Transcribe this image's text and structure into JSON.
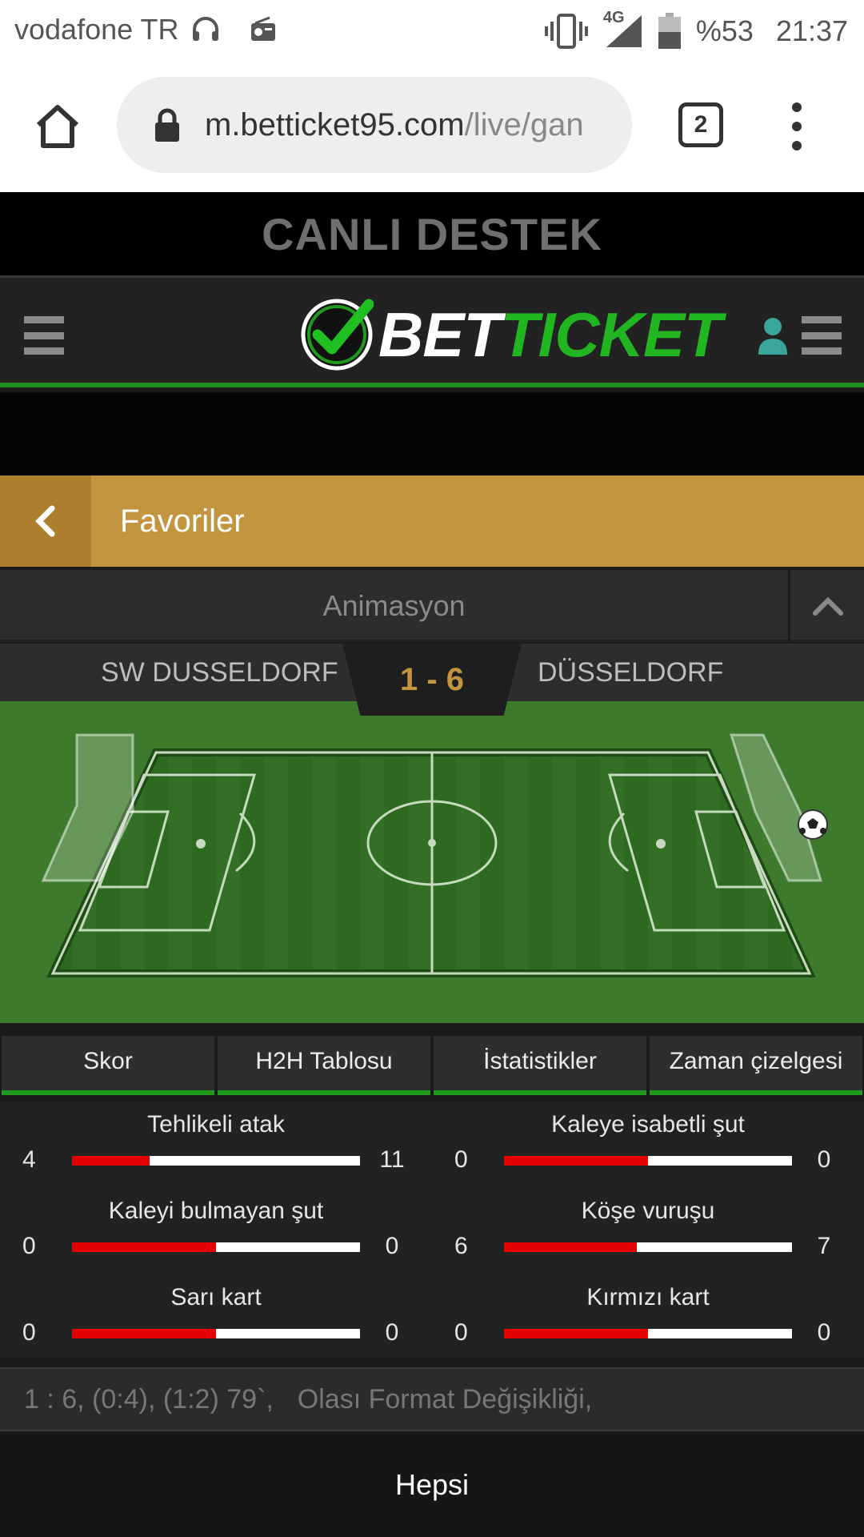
{
  "status_bar": {
    "carrier": "vodafone TR",
    "network": "4G",
    "battery": "%53",
    "time": "21:37",
    "icons": [
      "headset-icon",
      "radio-icon",
      "vibrate-icon",
      "signal-icon",
      "battery-icon"
    ]
  },
  "browser": {
    "url_host": "m.betticket95.com",
    "url_path": "/live/gan",
    "tab_count": "2"
  },
  "support_banner": "CANLI DESTEK",
  "header": {
    "logo_part1": "BET",
    "logo_part2": "TICKET",
    "colors": {
      "accent_green": "#1f9a1f",
      "gold": "#c4953f"
    }
  },
  "favorites": {
    "title": "Favoriler"
  },
  "animation": {
    "label": "Animasyon"
  },
  "match": {
    "home_team": "SW DUSSELDORF",
    "away_team": "DÜSSELDORF",
    "score": "1 - 6"
  },
  "tabs": [
    "Skor",
    "H2H Tablosu",
    "İstatistikler",
    "Zaman çizelgesi"
  ],
  "stats": [
    {
      "title": "Tehlikeli atak",
      "home": "4",
      "away": "11",
      "home_fraction": 0.27
    },
    {
      "title": "Kaleye isabetli şut",
      "home": "0",
      "away": "0",
      "home_fraction": 0.5
    },
    {
      "title": "Kaleyi bulmayan şut",
      "home": "0",
      "away": "0",
      "home_fraction": 0.5
    },
    {
      "title": "Köşe vuruşu",
      "home": "6",
      "away": "7",
      "home_fraction": 0.46
    },
    {
      "title": "Sarı kart",
      "home": "0",
      "away": "0",
      "home_fraction": 0.5
    },
    {
      "title": "Kırmızı kart",
      "home": "0",
      "away": "0",
      "home_fraction": 0.5
    }
  ],
  "event_line": {
    "score_detail": "1 : 6, (0:4), (1:2) 79`,",
    "note": "Olası Format Değişikliği,"
  },
  "footer": {
    "label": "Hepsi"
  }
}
